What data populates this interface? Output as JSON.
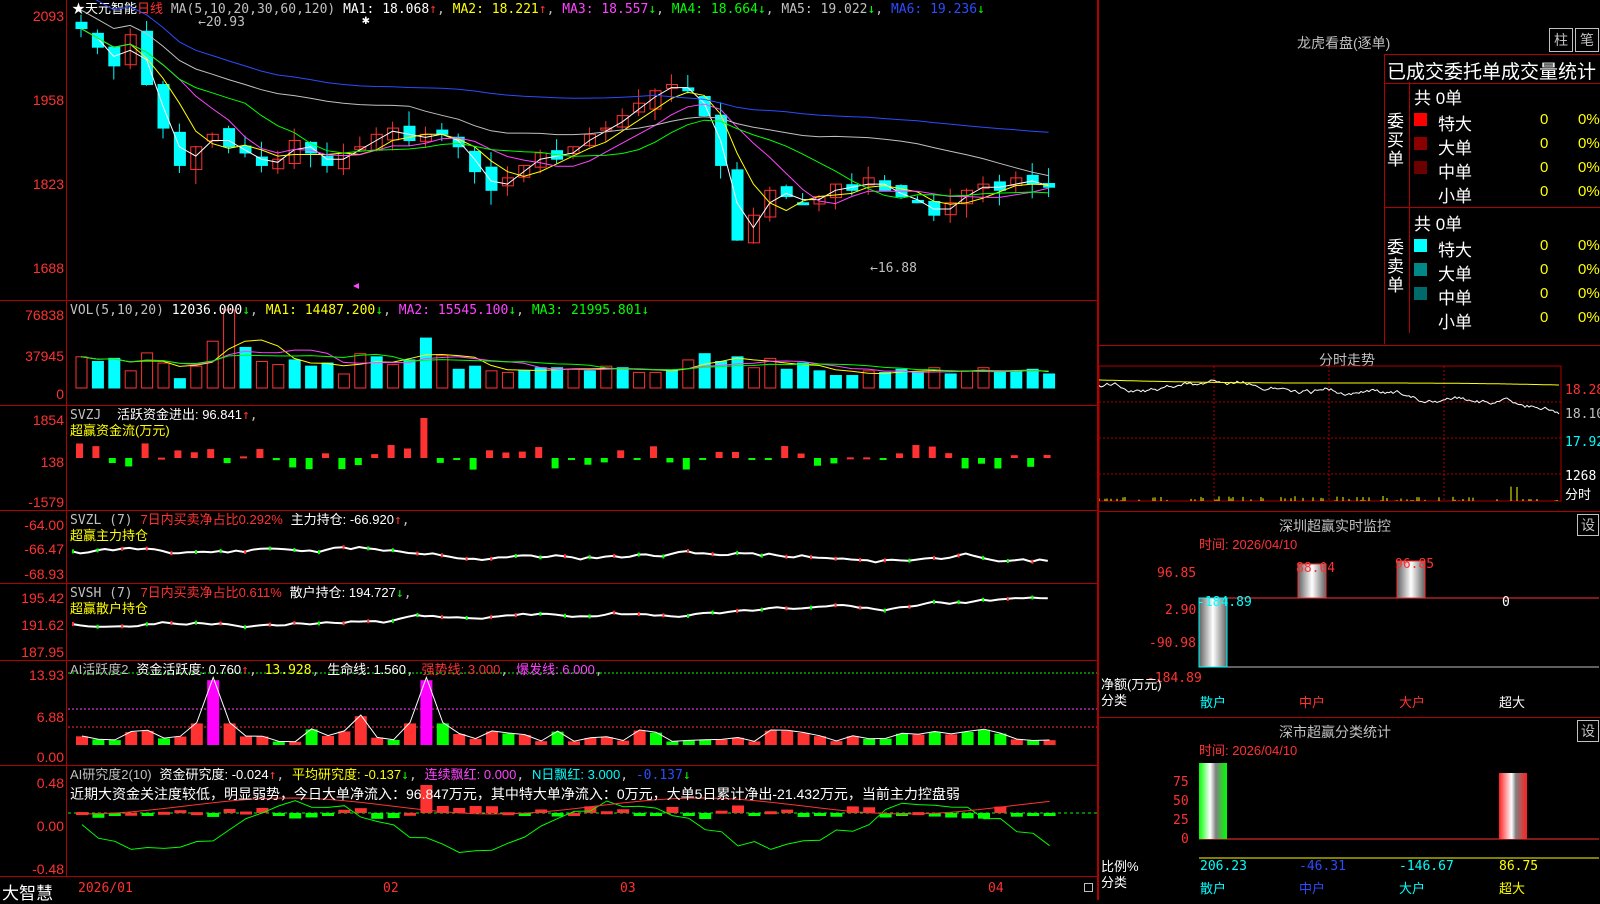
{
  "colors": {
    "up": "#ff3232",
    "down": "#00ffff",
    "grid": "#b00000",
    "ma1": "#ffffff",
    "ma2": "#ffff00",
    "ma3": "#ff44ff",
    "ma4": "#00ff00",
    "ma5": "#c0c0c0",
    "ma6": "#2b4cff"
  },
  "main": {
    "stock_name": "★天元智能",
    "period": "日线",
    "ma_label": "MA(5,10,20,30,60,120)",
    "ma1": "MA1: 18.068",
    "ma2": "MA2: 18.221",
    "ma3": "MA3: 18.557",
    "ma4": "MA4: 18.664",
    "ma5": "MA5: 19.022",
    "ma6": "MA6: 19.236",
    "y_labels": [
      "2093",
      "1958",
      "1823",
      "1688"
    ],
    "high_note": "20.93",
    "low_note": "16.88",
    "star": "✱"
  },
  "vol": {
    "title": "VOL(5,10,20)",
    "value": "12036.000",
    "ma1": "MA1: 14487.200",
    "ma2": "MA2: 15545.100",
    "ma3": "MA3: 21995.801",
    "y_labels": [
      "76838",
      "37945",
      "0"
    ]
  },
  "svzj": {
    "title": "SVZJ",
    "label": "活跃资金进出: 96.841",
    "sub": "超赢资金流(万元)",
    "y_labels": [
      "1854",
      "138",
      "-1579"
    ]
  },
  "svzl": {
    "title": "SVZL (7)",
    "ratio": "7日内买卖净占比0.292%",
    "hold": "主力持仓: -66.920",
    "sub": "超赢主力持仓",
    "y_labels": [
      "-64.00",
      "-66.47",
      "-68.93"
    ]
  },
  "svsh": {
    "title": "SVSH (7)",
    "ratio": "7日内买卖净占比0.611%",
    "hold": "散户持仓: 194.727",
    "sub": "超赢散户持仓",
    "y_labels": [
      "195.42",
      "191.62",
      "187.95"
    ]
  },
  "ai1": {
    "title": "AI活跃度2",
    "act": "资金活跃度: 0.760",
    "v2": "13.928",
    "life": "生命线: 1.560",
    "strong": "强势线: 3.000",
    "burst": "爆发线: 6.000",
    "y_labels": [
      "13.93",
      "6.88",
      "0.00"
    ]
  },
  "ai2": {
    "title": "AI研究度2(10)",
    "res": "资金研究度: -0.024",
    "avg": "平均研究度: -0.137",
    "red": "连续飘红: 0.000",
    "nred": "N日飘红: 3.000",
    "last": "-0.137",
    "y_labels": [
      "0.48",
      "0.00",
      "-0.48"
    ],
    "summary": "近期大资金关注度较低，明显弱势，今日大单净流入：96.847万元，其中特大单净流入：0万元，大单5日累计净出-21.432万元，当前主力控盘弱"
  },
  "xaxis": {
    "brand": "大智慧",
    "labels": [
      "2026/01",
      "02",
      "03",
      "04"
    ]
  },
  "orders": {
    "header": "龙虎看盘(逐单)",
    "btn1": "柱",
    "btn2": "笔",
    "title": "已成交委托单成交量统计",
    "buy": {
      "side": "委买单",
      "total": "共 0单",
      "rows": [
        {
          "name": "特大",
          "qty": "0",
          "pct": "0%"
        },
        {
          "name": "大单",
          "qty": "0",
          "pct": "0%"
        },
        {
          "name": "中单",
          "qty": "0",
          "pct": "0%"
        },
        {
          "name": "小单",
          "qty": "0",
          "pct": "0%"
        }
      ]
    },
    "sell": {
      "side": "委卖单",
      "total": "共 0单",
      "rows": [
        {
          "name": "特大",
          "qty": "0",
          "pct": "0%"
        },
        {
          "name": "大单",
          "qty": "0",
          "pct": "0%"
        },
        {
          "name": "中单",
          "qty": "0",
          "pct": "0%"
        },
        {
          "name": "小单",
          "qty": "0",
          "pct": "0%"
        }
      ]
    }
  },
  "intraday": {
    "title": "分时走势",
    "y_labels": [
      "18.28",
      "18.10",
      "17.92"
    ],
    "vol_label": "1268",
    "unit": "分时"
  },
  "monitor": {
    "title": "深圳超赢实时监控",
    "btn": "设",
    "time": "时间: 2026/04/10",
    "y_labels": [
      "96.85",
      "2.90",
      "-90.98",
      "-184.89"
    ],
    "values": [
      "-184.89",
      "88.04",
      "96.85",
      "0"
    ],
    "cats": [
      "散户",
      "中户",
      "大户",
      "超大"
    ],
    "yname": "净额(万元)",
    "xname": "分类"
  },
  "stats": {
    "title": "深市超赢分类统计",
    "btn": "设",
    "time": "时间: 2026/04/10",
    "y_labels": [
      "75",
      "50",
      "25",
      "0"
    ],
    "values": [
      "206.23",
      "-46.31",
      "-146.67",
      "86.75"
    ],
    "cats": [
      "散户",
      "中户",
      "大户",
      "超大"
    ],
    "yname": "比例%",
    "xname": "分类"
  }
}
